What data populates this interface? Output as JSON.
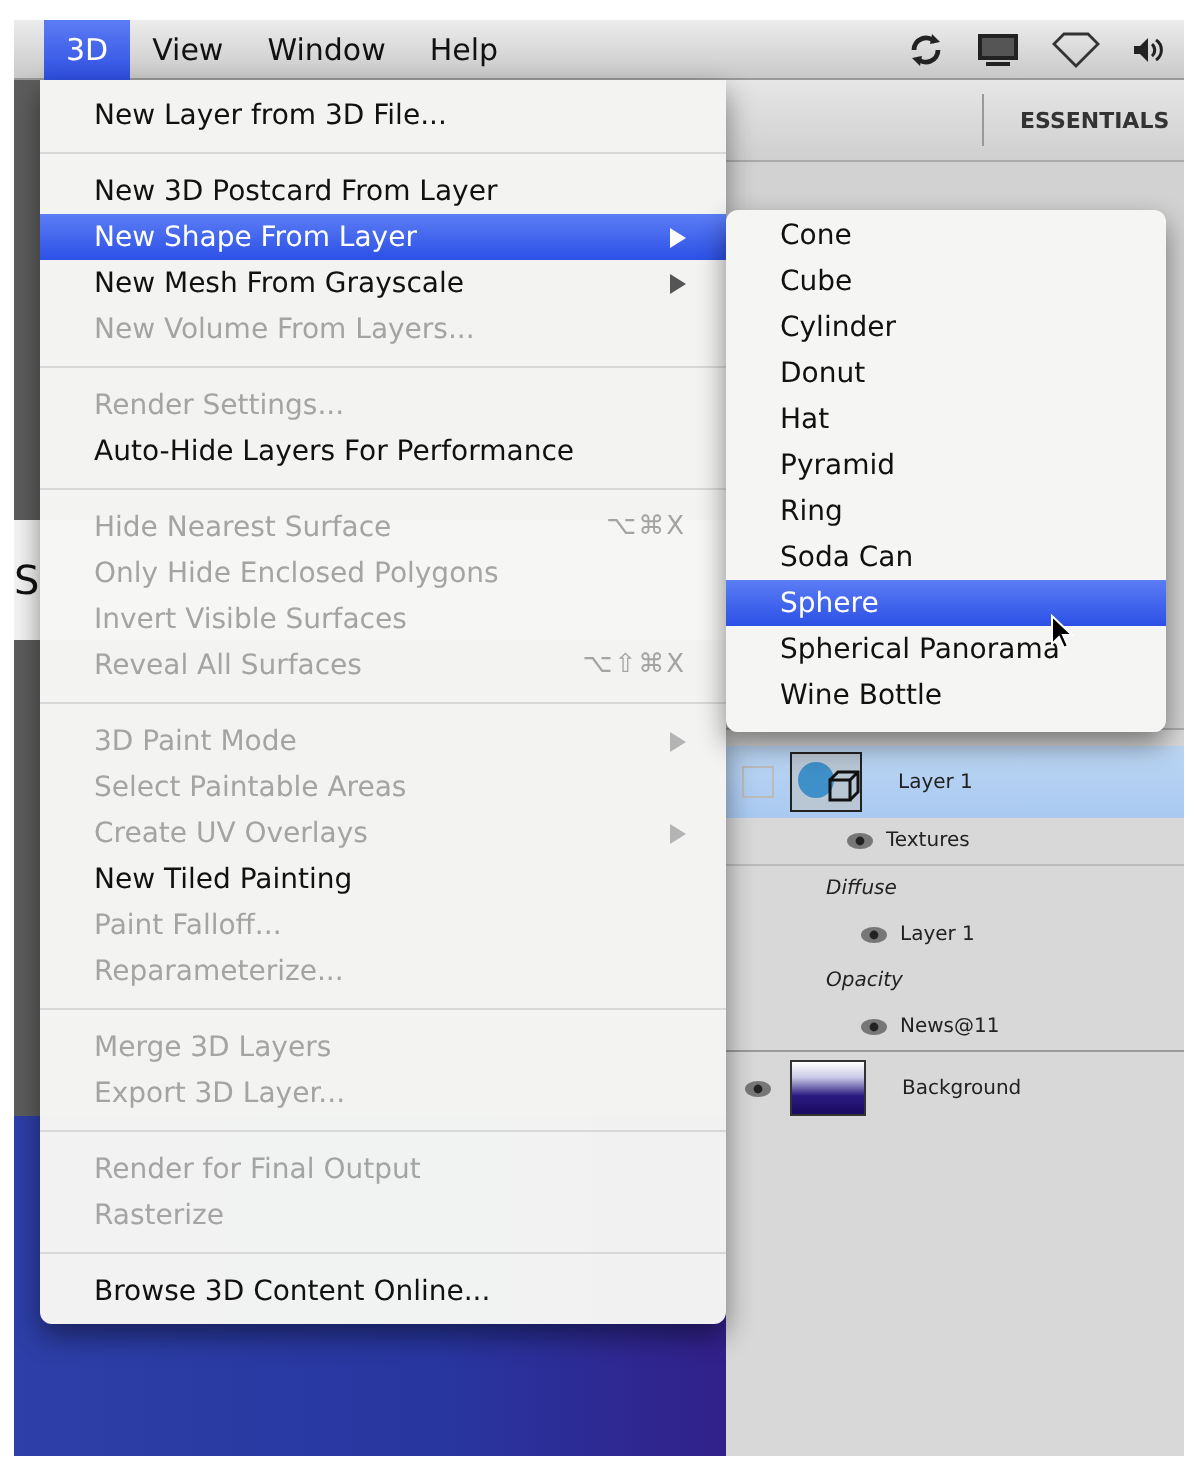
{
  "menu_bar": {
    "menus": [
      {
        "label": "3D",
        "selected": true
      },
      {
        "label": "View",
        "selected": false
      },
      {
        "label": "Window",
        "selected": false
      },
      {
        "label": "Help",
        "selected": false
      }
    ]
  },
  "toolbar": {
    "workspace": "ESSENTIALS"
  },
  "side_text": "S",
  "menu": {
    "items": [
      {
        "kind": "item",
        "label": "New Layer from 3D File...",
        "disabled": false,
        "selected": false
      },
      {
        "kind": "separator"
      },
      {
        "kind": "item",
        "label": "New 3D Postcard From Layer",
        "disabled": false,
        "selected": false
      },
      {
        "kind": "item",
        "label": "New Shape From Layer",
        "disabled": false,
        "selected": true,
        "submenu": true
      },
      {
        "kind": "item",
        "label": "New Mesh From Grayscale",
        "disabled": false,
        "selected": false,
        "submenu": true
      },
      {
        "kind": "item",
        "label": "New Volume From Layers...",
        "disabled": true,
        "selected": false
      },
      {
        "kind": "separator"
      },
      {
        "kind": "item",
        "label": "Render Settings...",
        "disabled": true,
        "selected": false
      },
      {
        "kind": "item",
        "label": "Auto-Hide Layers For Performance",
        "disabled": false,
        "selected": false
      },
      {
        "kind": "separator"
      },
      {
        "kind": "item",
        "label": "Hide Nearest Surface",
        "disabled": true,
        "selected": false,
        "shortcut": "⌥⌘X"
      },
      {
        "kind": "item",
        "label": "Only Hide Enclosed Polygons",
        "disabled": true,
        "selected": false
      },
      {
        "kind": "item",
        "label": "Invert Visible Surfaces",
        "disabled": true,
        "selected": false
      },
      {
        "kind": "item",
        "label": "Reveal All Surfaces",
        "disabled": true,
        "selected": false,
        "shortcut": "⌥⇧⌘X"
      },
      {
        "kind": "separator"
      },
      {
        "kind": "item",
        "label": "3D Paint Mode",
        "disabled": true,
        "selected": false,
        "submenu": true
      },
      {
        "kind": "item",
        "label": "Select Paintable Areas",
        "disabled": true,
        "selected": false
      },
      {
        "kind": "item",
        "label": "Create UV Overlays",
        "disabled": true,
        "selected": false,
        "submenu": true
      },
      {
        "kind": "item",
        "label": "New Tiled Painting",
        "disabled": false,
        "selected": false
      },
      {
        "kind": "item",
        "label": "Paint Falloff...",
        "disabled": true,
        "selected": false
      },
      {
        "kind": "item",
        "label": "Reparameterize...",
        "disabled": true,
        "selected": false
      },
      {
        "kind": "separator"
      },
      {
        "kind": "item",
        "label": "Merge 3D Layers",
        "disabled": true,
        "selected": false
      },
      {
        "kind": "item",
        "label": "Export 3D Layer...",
        "disabled": true,
        "selected": false
      },
      {
        "kind": "separator"
      },
      {
        "kind": "item",
        "label": "Render for Final Output",
        "disabled": true,
        "selected": false
      },
      {
        "kind": "item",
        "label": "Rasterize",
        "disabled": true,
        "selected": false
      },
      {
        "kind": "separator"
      },
      {
        "kind": "item",
        "label": "Browse 3D Content Online...",
        "disabled": false,
        "selected": false
      }
    ]
  },
  "submenu": {
    "items": [
      {
        "label": "Cone",
        "selected": false
      },
      {
        "label": "Cube",
        "selected": false
      },
      {
        "label": "Cylinder",
        "selected": false
      },
      {
        "label": "Donut",
        "selected": false
      },
      {
        "label": "Hat",
        "selected": false
      },
      {
        "label": "Pyramid",
        "selected": false
      },
      {
        "label": "Ring",
        "selected": false
      },
      {
        "label": "Soda Can",
        "selected": false
      },
      {
        "label": "Sphere",
        "selected": true
      },
      {
        "label": "Spherical Panorama",
        "selected": false
      },
      {
        "label": "Wine Bottle",
        "selected": false
      }
    ]
  },
  "layers": {
    "items": [
      {
        "name": "Layer 1",
        "kind": "model",
        "selected": true,
        "visible": false,
        "children": [
          {
            "kind": "group",
            "label": "Textures",
            "children": [
              {
                "kind": "heading",
                "label": "Diffuse",
                "children": [
                  {
                    "kind": "texture",
                    "label": "Layer 1"
                  }
                ]
              },
              {
                "kind": "heading",
                "label": "Opacity",
                "children": [
                  {
                    "kind": "texture",
                    "label": "News@11"
                  }
                ]
              }
            ]
          }
        ]
      },
      {
        "name": "Background",
        "kind": "image",
        "selected": false,
        "visible": true
      }
    ]
  }
}
